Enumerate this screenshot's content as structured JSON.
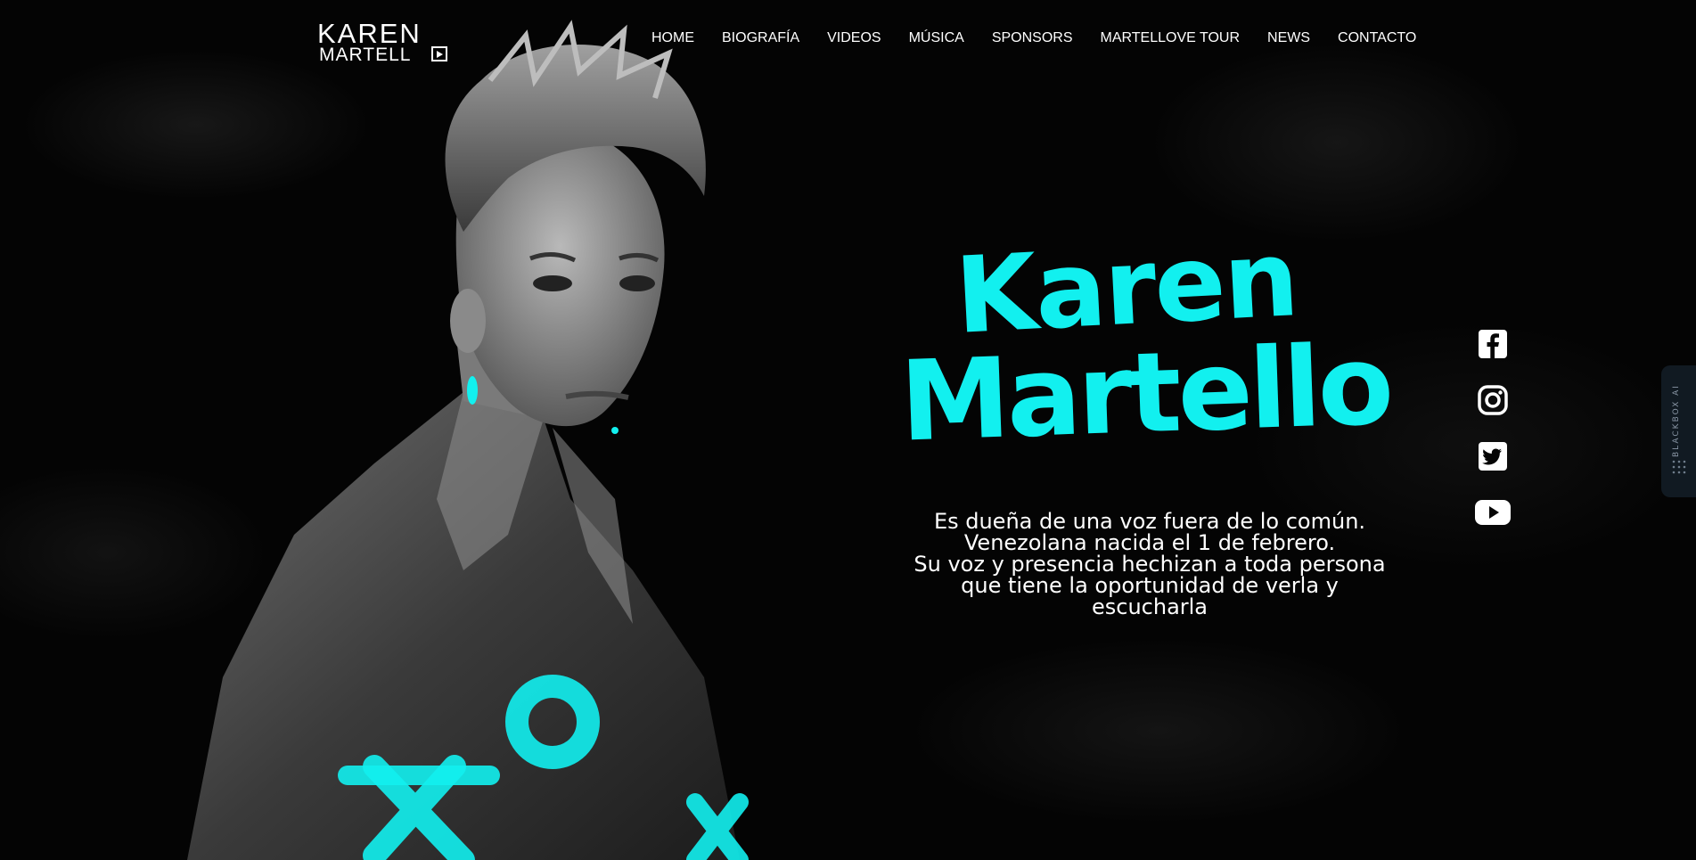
{
  "logo": {
    "line1": "KAREN",
    "line2": "MARTELL"
  },
  "nav": {
    "items": [
      {
        "label": "HOME"
      },
      {
        "label": "BIOGRAFÍA"
      },
      {
        "label": "VIDEOS"
      },
      {
        "label": "MÚSICA"
      },
      {
        "label": "SPONSORS"
      },
      {
        "label": "MARTELLOVE TOUR"
      },
      {
        "label": "NEWS"
      },
      {
        "label": "CONTACTO"
      }
    ]
  },
  "hero": {
    "title_line1": "Karen",
    "title_line2": "Martello",
    "tagline": [
      "Es dueña de una voz fuera de lo común.",
      "Venezolana nacida el 1 de febrero.",
      "Su voz y presencia hechizan a toda persona",
      "que tiene la oportunidad de verla y",
      "escucharla"
    ]
  },
  "social": [
    "facebook-icon",
    "instagram-icon",
    "twitter-icon",
    "youtube-icon"
  ],
  "side_tab": {
    "label": "BLACKBOX AI"
  },
  "colors": {
    "accent": "#12f0ef",
    "background": "#050505",
    "text": "#ffffff"
  }
}
